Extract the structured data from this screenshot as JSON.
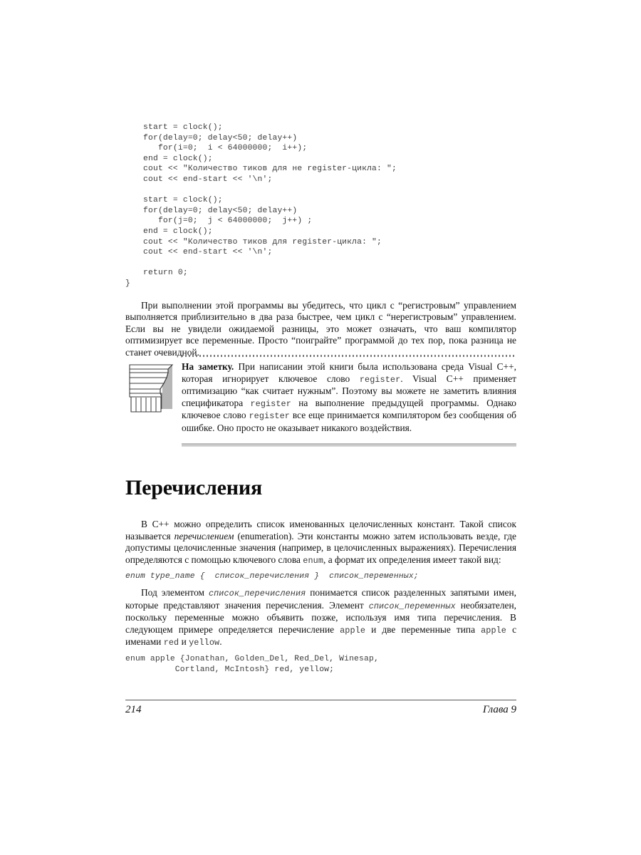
{
  "page": {
    "number": "214",
    "chapter": "Глава 9"
  },
  "code_top": {
    "block1": [
      "start = clock();",
      "for(delay=0; delay<50; delay++)",
      "   for(i=0;  i < 64000000;  i++);",
      "end = clock();",
      "cout << \"Количество тиков для не register-цикла: \";",
      "cout << end-start << '\\n';"
    ],
    "block2": [
      "start = clock();",
      "for(delay=0; delay<50; delay++)",
      "   for(j=0;  j < 64000000;  j++) ;",
      "end = clock();",
      "cout << \"Количество тиков для register-цикла: \";",
      "cout << end-start << '\\n';"
    ],
    "block3": [
      "return 0;"
    ],
    "closing_brace": "}"
  },
  "paragraph_after_code": "При выполнении этой программы вы убедитесь, что цикл с “регистровым” управлением выполняется приблизительно в два раза быстрее, чем цикл с “нерегистровым” управлением. Если вы не увидели ожидаемой разницы, это может означать, что ваш компилятор оптимизирует все переменные. Просто “поиграйте” программой до тех пор, пока разница не станет очевидной.",
  "note": {
    "icon_name": "classical-column-capital-icon",
    "lead": "На заметку.",
    "text_1": " При написании этой книги была использована среда Visual C++, которая игнорирует ключевое слово ",
    "code_1": "register",
    "text_2": ". Visual C++ применяет оптимизацию “как считает нужным”. Поэтому вы можете не заметить влияния спецификатора ",
    "code_2": "register",
    "text_3": " на выполнение предыдущей программы. Однако ключевое слово ",
    "code_3": "register",
    "text_4": " все еще принимается компилятором без сообщения об ошибке. Оно просто не оказывает никакого воздействия."
  },
  "section": {
    "heading": "Перечисления"
  },
  "para_1": {
    "text_1": "В С++ можно определить список именованных целочисленных констант. Такой список называется ",
    "italic_1": "перечислением",
    "text_2": " (enumeration). Эти константы можно затем использовать везде, где допустимы целочисленные значения (например, в целочисленных выражениях). Перечисления определяются с помощью ключевого слова ",
    "code_1": "enum",
    "text_3": ", а формат их определения имеет такой вид:"
  },
  "syntax_line": "enum type_name {  список_перечисления }  список_переменных;",
  "para_2": {
    "text_1": "Под элементом ",
    "code_1": "список_перечисления",
    "text_2": " понимается список разделенных запятыми имен, которые представляют значения перечисления. Элемент ",
    "code_2": "список_переменных",
    "text_3": " необязателен, поскольку переменные можно объявить позже, используя имя типа перечисления. В следующем примере определяется перечисление ",
    "code_3": "apple",
    "text_4": " и две переменные типа ",
    "code_4": "apple",
    "text_5": " с именами ",
    "code_5": "red",
    "text_6": " и ",
    "code_6": "yellow",
    "text_7": "."
  },
  "code_bottom": [
    "enum apple {Jonathan, Golden_Del, Red_Del, Winesap,",
    "          Cortland, McIntosh} red, yellow;"
  ],
  "colors": {
    "code_text": "#3a3a3a",
    "body_text": "#101010",
    "rule": "#555555",
    "note_bar": "#c9c9c9",
    "note_dots": "#7c7c7c"
  }
}
